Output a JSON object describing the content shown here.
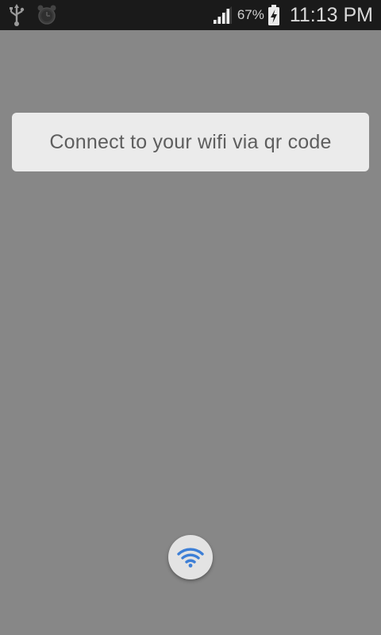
{
  "status_bar": {
    "icons_left": [
      "usb-icon",
      "alarm-clock-icon"
    ],
    "signal_icon": "signal-bars-icon",
    "battery_percent": "67%",
    "battery_icon": "battery-charging-icon",
    "time": "11:13 PM"
  },
  "main": {
    "connect_label": "Connect to your wifi via qr code"
  },
  "fab": {
    "icon": "wifi-icon",
    "accent_color": "#3d7fd6"
  }
}
